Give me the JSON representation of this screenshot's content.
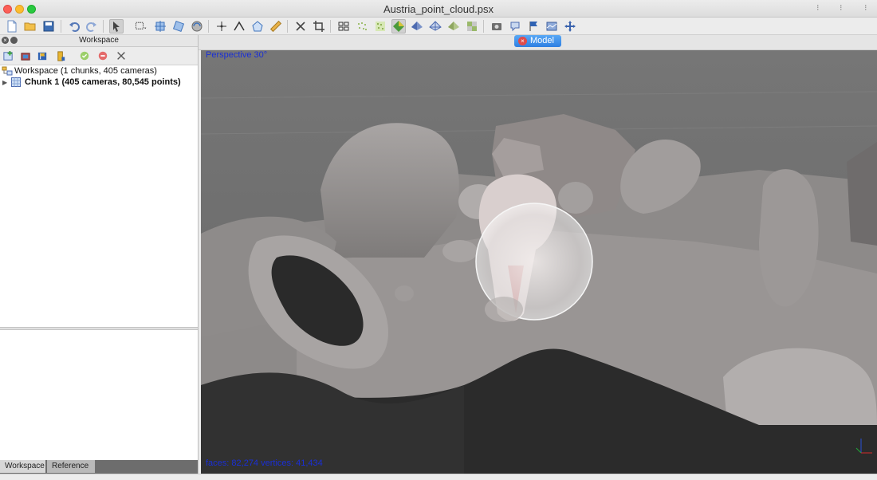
{
  "window": {
    "title": "Austria_point_cloud.psx"
  },
  "toolbar": {
    "icons": [
      "new-file-icon",
      "open-folder-icon",
      "save-icon",
      "undo-icon",
      "redo-icon",
      "navigation-icon",
      "rectangle-selection-icon",
      "resize-region-icon",
      "rotate-region-icon",
      "rotate-object-icon",
      "ruler-point-icon",
      "draw-polyline-icon",
      "draw-polygon-icon",
      "ruler-icon",
      "delete-selection-icon",
      "crop-selection-icon",
      "show-cameras-icon",
      "point-cloud-icon",
      "dense-cloud-icon",
      "model-solid-icon",
      "model-shaded-icon",
      "model-wireframe-icon",
      "model-textured-icon",
      "tiled-model-icon",
      "camera-icon",
      "shapes-icon",
      "markers-icon",
      "dem-icon",
      "orthomosaic-icon",
      "move-icon"
    ]
  },
  "workspace_panel": {
    "title": "Workspace",
    "root_label": "Workspace (1 chunks, 405 cameras)",
    "chunk_label": "Chunk 1 (405 cameras, 80,545 points)"
  },
  "tabs": [
    {
      "label": "Workspace",
      "active": true
    },
    {
      "label": "Reference",
      "active": false
    }
  ],
  "model": {
    "tab_label": "Model",
    "view_mode": "Perspective 30°",
    "stats": "faces: 82,274 vertices: 41,434"
  },
  "colors": {
    "accent": "#2e7fe2",
    "overlay_text": "#1a2fd6",
    "viewport_bg": "#6f6f6f"
  }
}
